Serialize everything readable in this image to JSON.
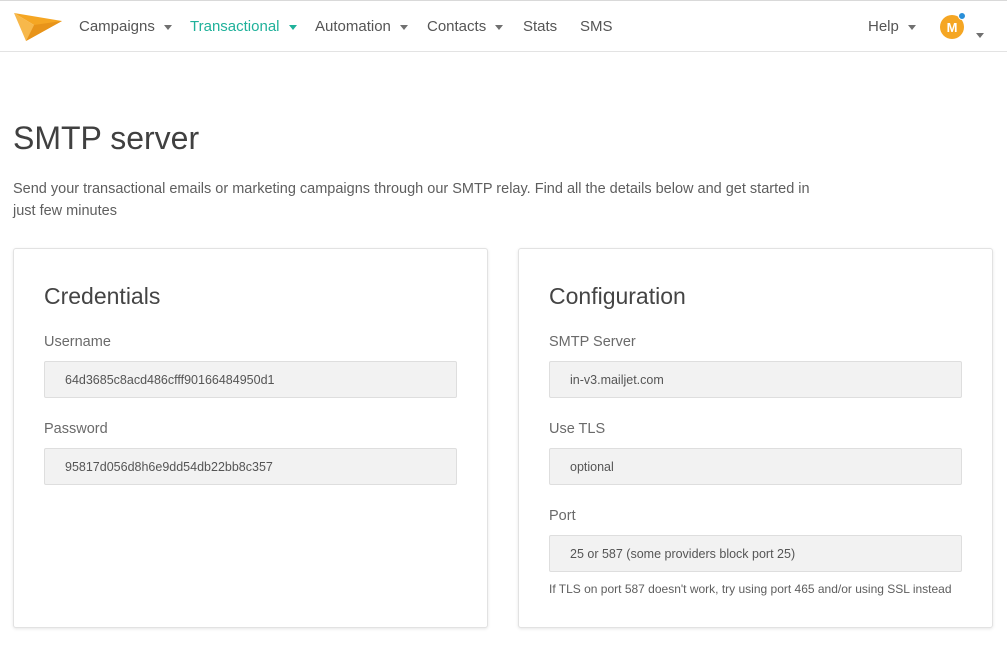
{
  "nav": {
    "items": [
      {
        "label": "Campaigns",
        "has_caret": true,
        "active": false
      },
      {
        "label": "Transactional",
        "has_caret": true,
        "active": true
      },
      {
        "label": "Automation",
        "has_caret": true,
        "active": false
      },
      {
        "label": "Contacts",
        "has_caret": true,
        "active": false
      },
      {
        "label": "Stats",
        "has_caret": false,
        "active": false
      },
      {
        "label": "SMS",
        "has_caret": false,
        "active": false
      }
    ],
    "help_label": "Help",
    "avatar_initial": "M",
    "logo_icon": "paper-plane-icon"
  },
  "colors": {
    "accent": "#1fb19a",
    "logo": "#f5a623",
    "avatar_bg": "#f5a623",
    "notification_dot": "#2a8fd8"
  },
  "page": {
    "title": "SMTP server",
    "description": "Send your transactional emails or marketing campaigns through our SMTP relay. Find all the details below and get started in just few minutes"
  },
  "credentials": {
    "title": "Credentials",
    "username_label": "Username",
    "username_value": "64d3685c8acd486cfff90166484950d1",
    "password_label": "Password",
    "password_value": "95817d056d8h6e9dd54db22bb8c357"
  },
  "configuration": {
    "title": "Configuration",
    "smtp_server_label": "SMTP Server",
    "smtp_server_value": "in-v3.mailjet.com",
    "tls_label": "Use TLS",
    "tls_value": "optional",
    "port_label": "Port",
    "port_value": "25 or 587 (some providers block port 25)",
    "port_hint": "If TLS on port 587 doesn't work, try using port 465 and/or using SSL instead"
  }
}
